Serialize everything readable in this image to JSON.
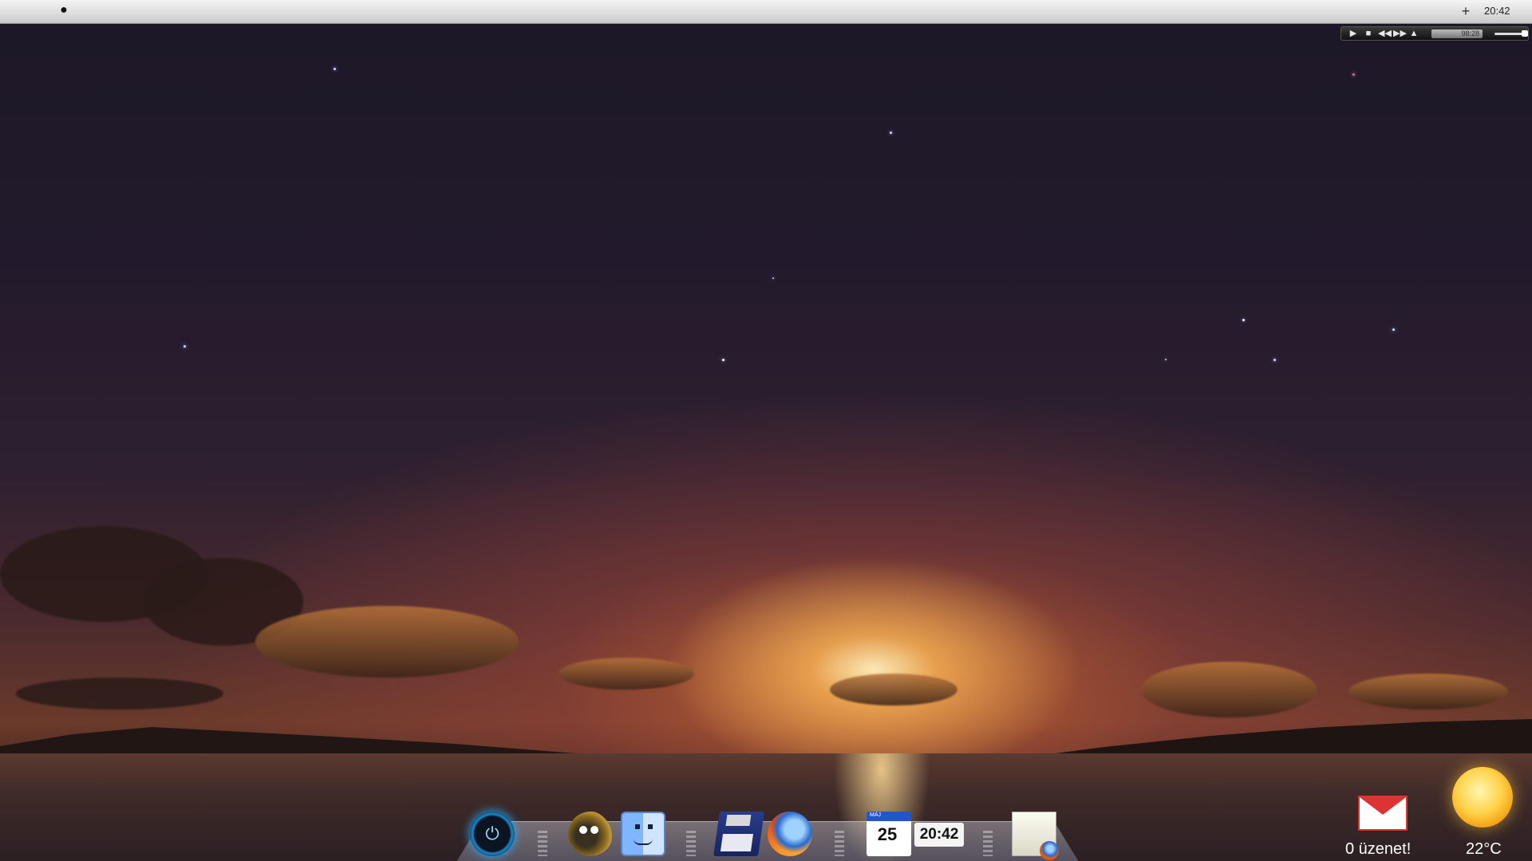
{
  "menubar": {
    "apple_icon": "apple-icon",
    "add_icon": "plus-icon",
    "clock": "20:42"
  },
  "mediabar": {
    "buttons": [
      "play-icon",
      "stop-icon",
      "rewind-icon",
      "fast-forward-icon",
      "eject-icon"
    ],
    "time": "98:28"
  },
  "dock": {
    "items": [
      "power-icon",
      "gimp-icon",
      "finder-icon",
      "floppy-disk-icon",
      "firefox-icon",
      "calendar-icon",
      "clock-widget",
      "mail-app-icon"
    ],
    "calendar_month": "MÁJ",
    "calendar_day": "25",
    "clock": "20:42"
  },
  "widgets": {
    "gmail": {
      "icon": "gmail-icon",
      "label": "0  üzenet!"
    },
    "weather": {
      "icon": "sun-icon",
      "temperature": "22°C"
    }
  },
  "colors": {
    "menubar": "#dcdcdc",
    "power_glow": "#2ab0ff",
    "gmail_red": "#dd3333",
    "sun": "#ffd24a"
  }
}
